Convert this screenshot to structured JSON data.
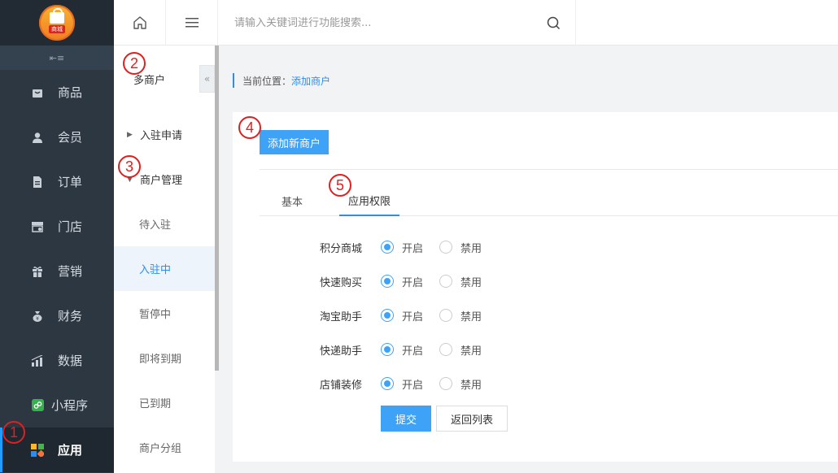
{
  "logo": {
    "text": "商城"
  },
  "sidebar": {
    "items": [
      {
        "label": "商品",
        "icon": "bag-icon"
      },
      {
        "label": "会员",
        "icon": "user-icon"
      },
      {
        "label": "订单",
        "icon": "document-icon"
      },
      {
        "label": "门店",
        "icon": "store-icon"
      },
      {
        "label": "营销",
        "icon": "gift-icon"
      },
      {
        "label": "财务",
        "icon": "moneybag-icon"
      },
      {
        "label": "数据",
        "icon": "bar-chart-icon"
      },
      {
        "label": "小程序",
        "icon": "mini-program-icon"
      },
      {
        "label": "应用",
        "icon": "apps-grid-icon",
        "active": true
      }
    ]
  },
  "subnav": {
    "title": "多商户",
    "groups": [
      {
        "label": "入驻申请",
        "expanded": false
      },
      {
        "label": "商户管理",
        "expanded": true
      }
    ],
    "items": [
      "待入驻",
      "入驻中",
      "暂停中",
      "即将到期",
      "已到期",
      "商户分组"
    ],
    "active_item": "入驻中"
  },
  "search": {
    "placeholder": "请输入关键词进行功能搜索..."
  },
  "breadcrumb": {
    "prefix": "当前位置：",
    "current": "添加商户"
  },
  "main": {
    "add_button": "添加新商户",
    "tabs": [
      "基本",
      "应用权限"
    ],
    "active_tab": "应用权限",
    "permissions": [
      {
        "label": "积分商城",
        "on_label": "开启",
        "off_label": "禁用",
        "value": "开启"
      },
      {
        "label": "快速购买",
        "on_label": "开启",
        "off_label": "禁用",
        "value": "开启"
      },
      {
        "label": "淘宝助手",
        "on_label": "开启",
        "off_label": "禁用",
        "value": "开启"
      },
      {
        "label": "快递助手",
        "on_label": "开启",
        "off_label": "禁用",
        "value": "开启"
      },
      {
        "label": "店铺装修",
        "on_label": "开启",
        "off_label": "禁用",
        "value": "开启"
      }
    ],
    "submit_label": "提交",
    "back_label": "返回列表"
  },
  "markers": [
    "1",
    "2",
    "3",
    "4",
    "5"
  ],
  "colors": {
    "accent": "#3ea3f7",
    "sidebar_bg": "#2d3741",
    "marker": "#e02020"
  }
}
